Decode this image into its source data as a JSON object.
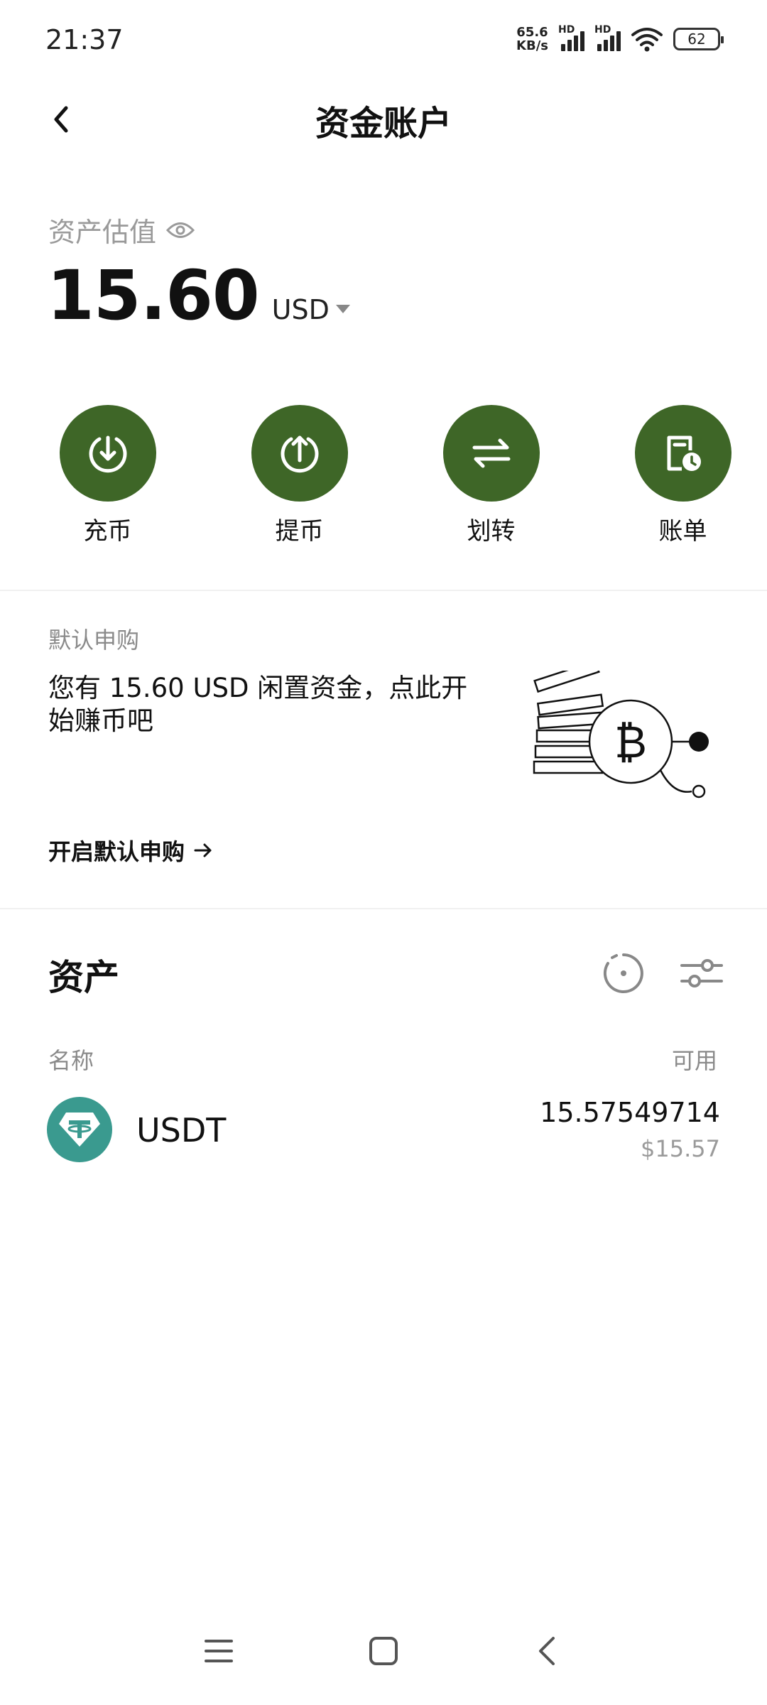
{
  "status_bar": {
    "time": "21:37",
    "net_speed_value": "65.6",
    "net_speed_unit": "KB/s",
    "signal_label": "HD",
    "battery": "62"
  },
  "header": {
    "title": "资金账户",
    "back_icon": "chevron-left-icon"
  },
  "balance": {
    "label": "资产估值",
    "value": "15.60",
    "currency": "USD"
  },
  "actions": [
    {
      "label": "充币",
      "icon": "deposit-icon"
    },
    {
      "label": "提币",
      "icon": "withdraw-icon"
    },
    {
      "label": "划转",
      "icon": "transfer-icon"
    },
    {
      "label": "账单",
      "icon": "bill-icon"
    }
  ],
  "promo": {
    "tag": "默认申购",
    "text": "您有 15.60 USD 闲置资金，点此开始赚币吧",
    "link": "开启默认申购"
  },
  "assets": {
    "title": "资产",
    "col_name": "名称",
    "col_available": "可用",
    "items": [
      {
        "symbol": "USDT",
        "amount": "15.57549714",
        "usd_value": "$15.57"
      }
    ]
  },
  "colors": {
    "accent_green": "#3e6627",
    "tether": "#3a9a8f"
  }
}
